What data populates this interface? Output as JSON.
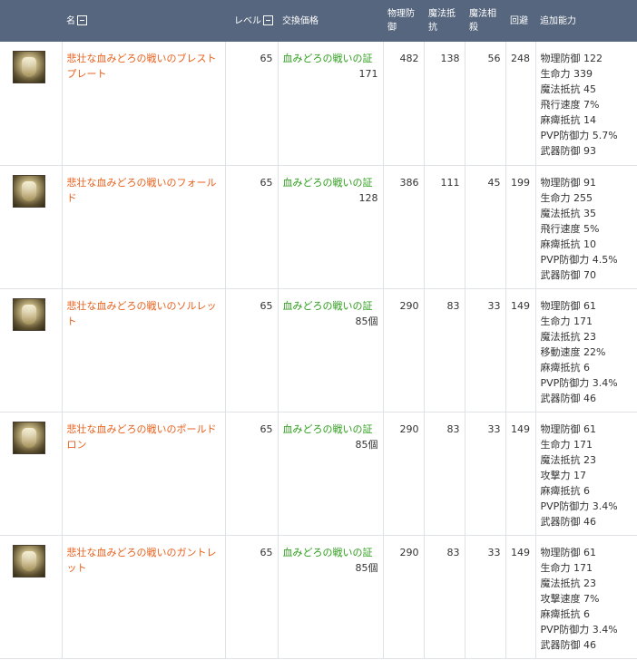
{
  "header": {
    "name": "名",
    "level": "レベル",
    "price": "交換価格",
    "phys_def": "物理防御",
    "magic_resist": "魔法抵抗",
    "magic_offset": "魔法相殺",
    "evasion": "回避",
    "bonus": "追加能力"
  },
  "rows": [
    {
      "name": "悲壮な血みどろの戦いのブレストプレート",
      "level": "65",
      "price_item": "血みどろの戦いの証",
      "price_qty": "171",
      "phys_def": "482",
      "magic_resist": "138",
      "magic_offset": "56",
      "evasion": "248",
      "bonuses": [
        "物理防御 122",
        "生命力 339",
        "魔法抵抗 45",
        "飛行速度 7%",
        "麻痺抵抗 14",
        "PVP防御力 5.7%",
        "武器防御 93"
      ]
    },
    {
      "name": "悲壮な血みどろの戦いのフォールド",
      "level": "65",
      "price_item": "血みどろの戦いの証",
      "price_qty": "128",
      "phys_def": "386",
      "magic_resist": "111",
      "magic_offset": "45",
      "evasion": "199",
      "bonuses": [
        "物理防御 91",
        "生命力 255",
        "魔法抵抗 35",
        "飛行速度 5%",
        "麻痺抵抗 10",
        "PVP防御力 4.5%",
        "武器防御 70"
      ]
    },
    {
      "name": "悲壮な血みどろの戦いのソルレット",
      "level": "65",
      "price_item": "血みどろの戦いの証",
      "price_qty": "85個",
      "phys_def": "290",
      "magic_resist": "83",
      "magic_offset": "33",
      "evasion": "149",
      "bonuses": [
        "物理防御 61",
        "生命力 171",
        "魔法抵抗 23",
        "移動速度 22%",
        "麻痺抵抗 6",
        "PVP防御力 3.4%",
        "武器防御 46"
      ]
    },
    {
      "name": "悲壮な血みどろの戦いのポールドロン",
      "level": "65",
      "price_item": "血みどろの戦いの証",
      "price_qty": "85個",
      "phys_def": "290",
      "magic_resist": "83",
      "magic_offset": "33",
      "evasion": "149",
      "bonuses": [
        "物理防御 61",
        "生命力 171",
        "魔法抵抗 23",
        "攻撃力 17",
        "麻痺抵抗 6",
        "PVP防御力 3.4%",
        "武器防御 46"
      ]
    },
    {
      "name": "悲壮な血みどろの戦いのガントレット",
      "level": "65",
      "price_item": "血みどろの戦いの証",
      "price_qty": "85個",
      "phys_def": "290",
      "magic_resist": "83",
      "magic_offset": "33",
      "evasion": "149",
      "bonuses": [
        "物理防御 61",
        "生命力 171",
        "魔法抵抗 23",
        "攻撃速度 7%",
        "麻痺抵抗 6",
        "PVP防御力 3.4%",
        "武器防御 46"
      ]
    }
  ],
  "icons": {
    "sort": "sort-minus-icon",
    "item": "armor-item-icon"
  }
}
